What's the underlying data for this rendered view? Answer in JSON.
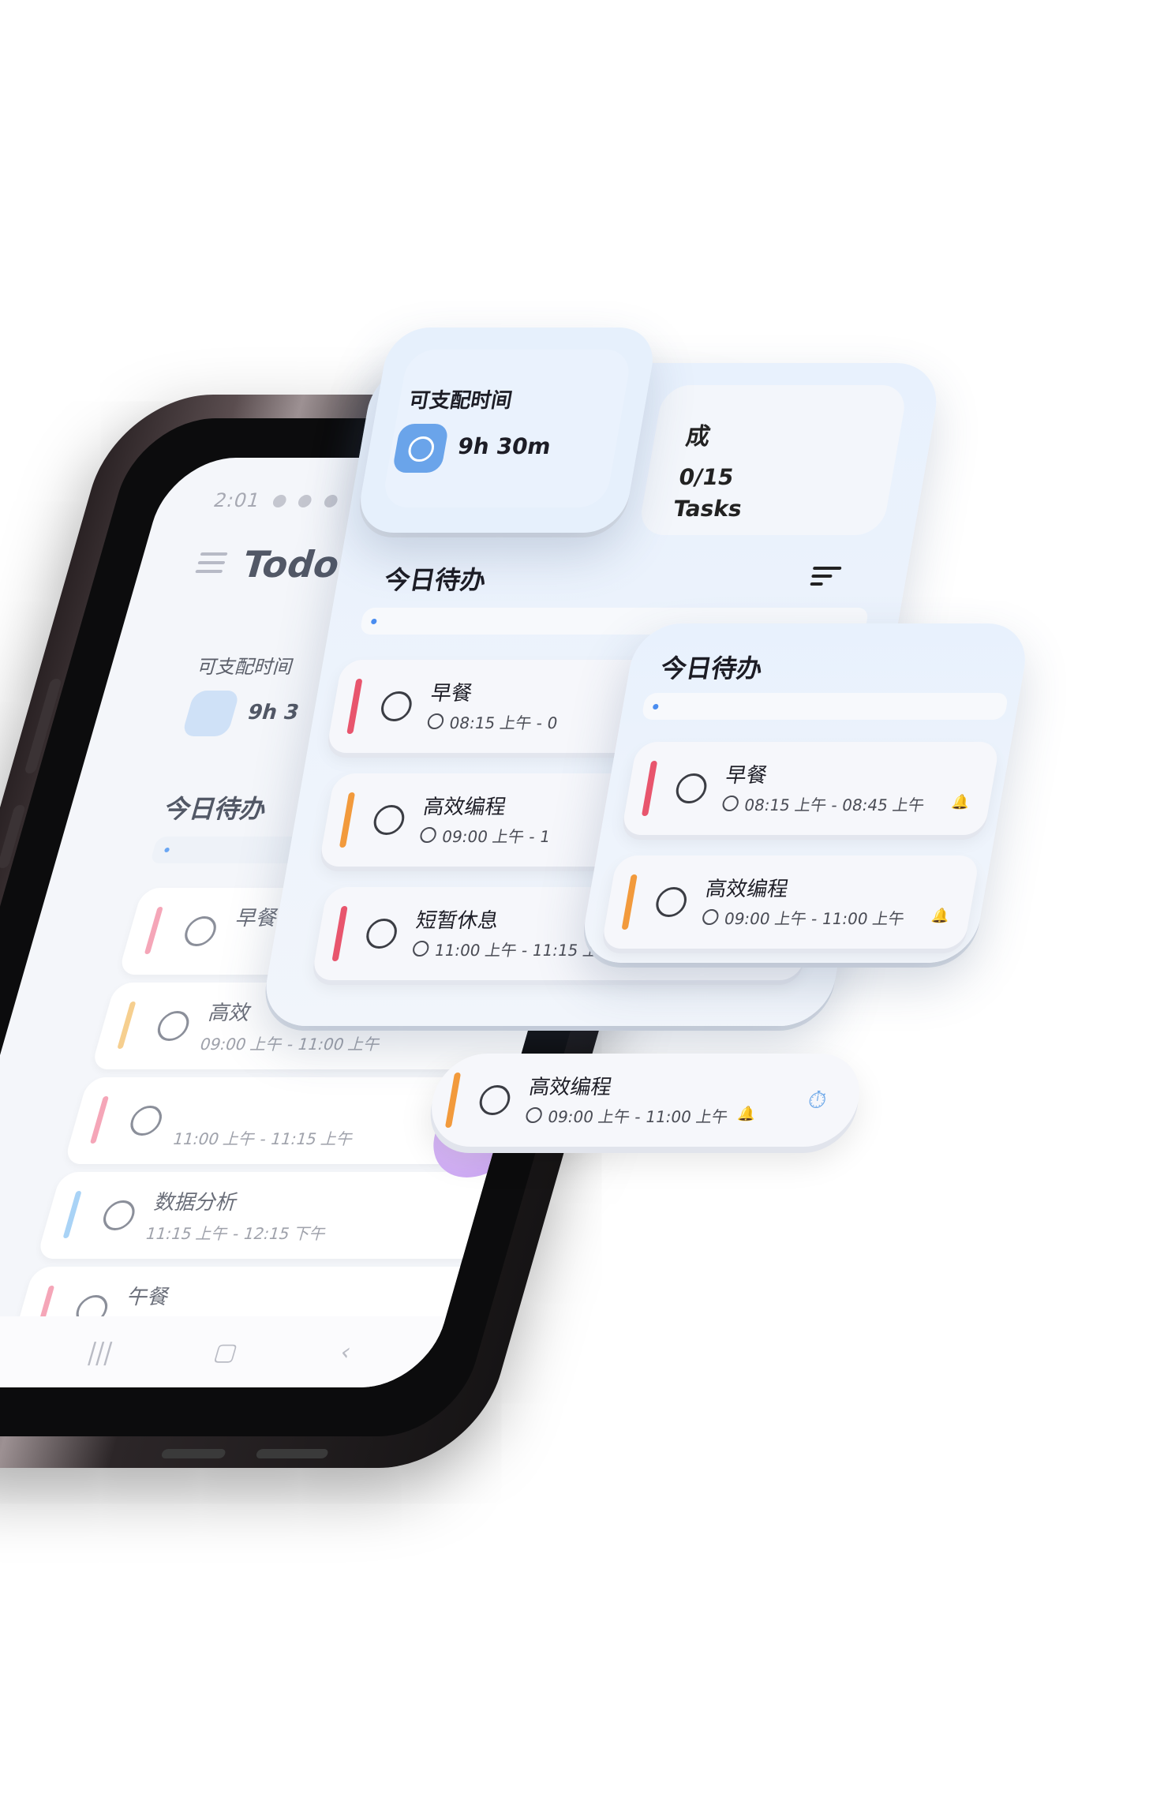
{
  "device": {
    "status_time": "2:01",
    "app_title": "Todo",
    "available_label": "可支配时间",
    "available_value_partial": "9h 3",
    "today_label": "今日待办",
    "tasks": [
      {
        "name": "早餐",
        "time": "",
        "color": "#f5a6b8"
      },
      {
        "name": "高效",
        "time": "09:00 上午 - 11:00 上午",
        "color": "#f6cf8f"
      },
      {
        "name": "",
        "time": "11:00 上午 - 11:15 上午",
        "color": "#f5a6b8"
      },
      {
        "name": "数据分析",
        "time": "11:15 上午 - 12:15 下午",
        "color": "#a9d3f6"
      },
      {
        "name": "午餐",
        "time": "",
        "color": "#f5a6b8"
      }
    ],
    "fab_label": "+",
    "nav": {
      "recent": "|||",
      "home": "▢",
      "back": "‹"
    }
  },
  "main_panel": {
    "available_label": "可支",
    "stat_icon_char": "成",
    "count": "0/15",
    "tasks_label": "Tasks",
    "today_label": "今日待办",
    "tasks": [
      {
        "name": "早餐",
        "time": "08:15 上午 - 0",
        "color": "#e8556d"
      },
      {
        "name": "高效编程",
        "time": "09:00 上午 - 1",
        "color": "#f29a3c"
      },
      {
        "name": "短暂休息",
        "time": "11:00 上午 - 11:15 上午",
        "color": "#e8556d"
      }
    ]
  },
  "top_panel": {
    "available_label": "可支配时间",
    "available_value": "9h 30m"
  },
  "right_panel": {
    "today_label": "今日待办",
    "tasks": [
      {
        "name": "早餐",
        "time": "08:15 上午 - 08:45 上午",
        "color": "#e8556d"
      },
      {
        "name": "高效编程",
        "time": "09:00 上午 - 11:00 上午",
        "color": "#f29a3c"
      }
    ]
  },
  "pill_task": {
    "name": "高效编程",
    "time": "09:00 上午 - 11:00 上午",
    "color": "#f29a3c"
  }
}
